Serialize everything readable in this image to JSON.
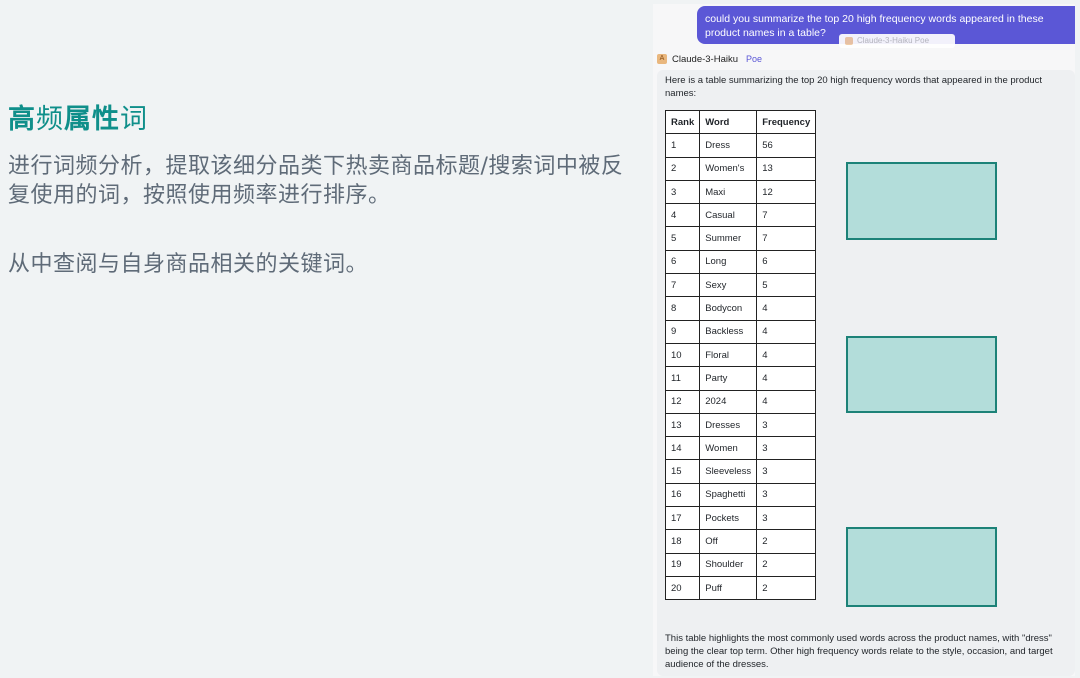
{
  "slide": {
    "title_parts": [
      "高",
      "频",
      "属性",
      "词"
    ],
    "description": "进行词频分析，提取该细分品类下热卖商品标题/搜索词中被反复使用的词，按照使用频率进行排序。",
    "note": "从中查阅与自身商品相关的关键词。"
  },
  "chat": {
    "user_message": "could you summarize the top 20 high frequency words appeared in these product names in a table?",
    "ghost_label": "Claude-3-Haiku   Poe",
    "bot_name": "Claude-3-Haiku",
    "bot_platform": "Poe",
    "bot_avatar_icon": "anthropic-logo-icon",
    "intro": "Here is a table summarizing the top 20 high frequency words that appeared in the product names:",
    "table_headers": [
      "Rank",
      "Word",
      "Frequency"
    ],
    "table_rows": [
      [
        "1",
        "Dress",
        "56"
      ],
      [
        "2",
        "Women's",
        "13"
      ],
      [
        "3",
        "Maxi",
        "12"
      ],
      [
        "4",
        "Casual",
        "7"
      ],
      [
        "5",
        "Summer",
        "7"
      ],
      [
        "6",
        "Long",
        "6"
      ],
      [
        "7",
        "Sexy",
        "5"
      ],
      [
        "8",
        "Bodycon",
        "4"
      ],
      [
        "9",
        "Backless",
        "4"
      ],
      [
        "10",
        "Floral",
        "4"
      ],
      [
        "11",
        "Party",
        "4"
      ],
      [
        "12",
        "2024",
        "4"
      ],
      [
        "13",
        "Dresses",
        "3"
      ],
      [
        "14",
        "Women",
        "3"
      ],
      [
        "15",
        "Sleeveless",
        "3"
      ],
      [
        "16",
        "Spaghetti",
        "3"
      ],
      [
        "17",
        "Pockets",
        "3"
      ],
      [
        "18",
        "Off",
        "2"
      ],
      [
        "19",
        "Shoulder",
        "2"
      ],
      [
        "20",
        "Puff",
        "2"
      ]
    ],
    "outro": "This table highlights the most commonly used words across the product names, with \"dress\" being the clear top term. Other high frequency words relate to the style, occasion, and target audience of the dresses."
  },
  "colors": {
    "title_accent": "#0f8f8a",
    "user_bubble": "#5b57d6",
    "highlight_box_fill": "#b3ddda",
    "highlight_box_border": "#1c8278"
  }
}
